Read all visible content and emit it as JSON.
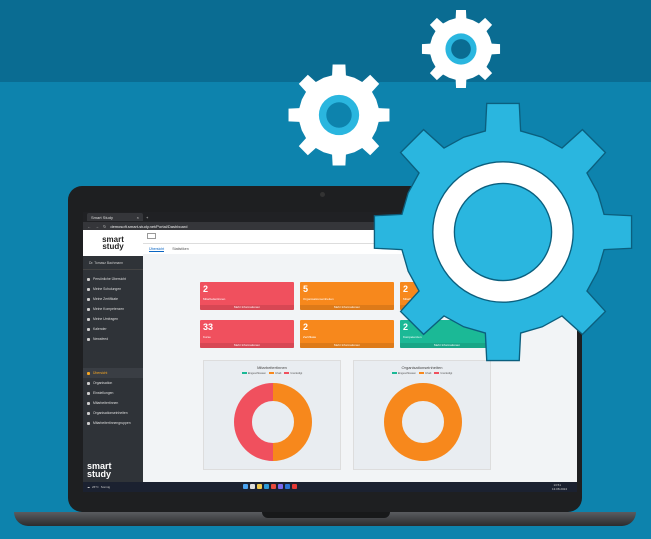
{
  "browser": {
    "tab_title": "Smart Study",
    "url": "demosoft.smart-study.net/Portal/Dashboard"
  },
  "brand": {
    "logo_line1": "smart",
    "logo_line2": "study"
  },
  "sidebar": {
    "user": "Dr. Tomasz Bachmann",
    "items": [
      {
        "label": "Persönliche Übersicht"
      },
      {
        "label": "Meine Schulungen"
      },
      {
        "label": "Meine Zertifikate"
      },
      {
        "label": "Meine Kompetenzen"
      },
      {
        "label": "Meine Umfragen"
      },
      {
        "label": "Kalender"
      },
      {
        "label": "Newsfeed"
      }
    ],
    "admin_items": [
      {
        "label": "Übersicht",
        "active": true
      },
      {
        "label": "Organisation"
      },
      {
        "label": "Einstellungen"
      },
      {
        "label": "Mitarbeitertinnen"
      },
      {
        "label": "Organisationseinheiten"
      },
      {
        "label": "Mitarbeitertinnengruppen"
      }
    ]
  },
  "tabs": {
    "overview": "Übersicht",
    "stats": "Statistiken"
  },
  "cards": [
    {
      "value": "2",
      "label": "Mitarbeitertinnen",
      "more": "Mehr Informationen",
      "color": "#f0505e"
    },
    {
      "value": "5",
      "label": "Organisationseinheiten",
      "more": "Mehr Informationen",
      "color": "#f7881c"
    },
    {
      "value": "2",
      "label": "Mitarbeitertinnengruppen",
      "more": "Mehr Informationen",
      "color": "#f7881c"
    },
    {
      "value": "33",
      "label": "Kurse",
      "more": "Mehr Informationen",
      "color": "#f0505e"
    },
    {
      "value": "2",
      "label": "Zertifikate",
      "more": "Mehr Informationen",
      "color": "#f7881c"
    },
    {
      "value": "2",
      "label": "Kompetenzen",
      "more": "Mehr Informationen",
      "color": "#1bb996"
    }
  ],
  "panels": [
    {
      "title": "Mitarbeitertinnen",
      "legend": [
        "Eingeschlossen",
        "Inhalt",
        "Unerledigt"
      ]
    },
    {
      "title": "Organisationseinheiten",
      "legend": [
        "Eingeschlossen",
        "Inhalt",
        "Unerledigt"
      ]
    }
  ],
  "taskbar": {
    "weather": "26°C",
    "weather_desc": "Sonnig",
    "time": "13:51",
    "date": "13.08.2024"
  },
  "chart_data": [
    {
      "type": "pie",
      "title": "Mitarbeitertinnen",
      "categories": [
        "Eingeschlossen",
        "Inhalt",
        "Unerledigt"
      ],
      "values": [
        0,
        50,
        50
      ],
      "colors": [
        "#1bb996",
        "#f7881c",
        "#f0505e"
      ]
    },
    {
      "type": "pie",
      "title": "Organisationseinheiten",
      "categories": [
        "Eingeschlossen",
        "Inhalt",
        "Unerledigt"
      ],
      "values": [
        0,
        100,
        0
      ],
      "colors": [
        "#1bb996",
        "#f7881c",
        "#f0505e"
      ]
    }
  ]
}
